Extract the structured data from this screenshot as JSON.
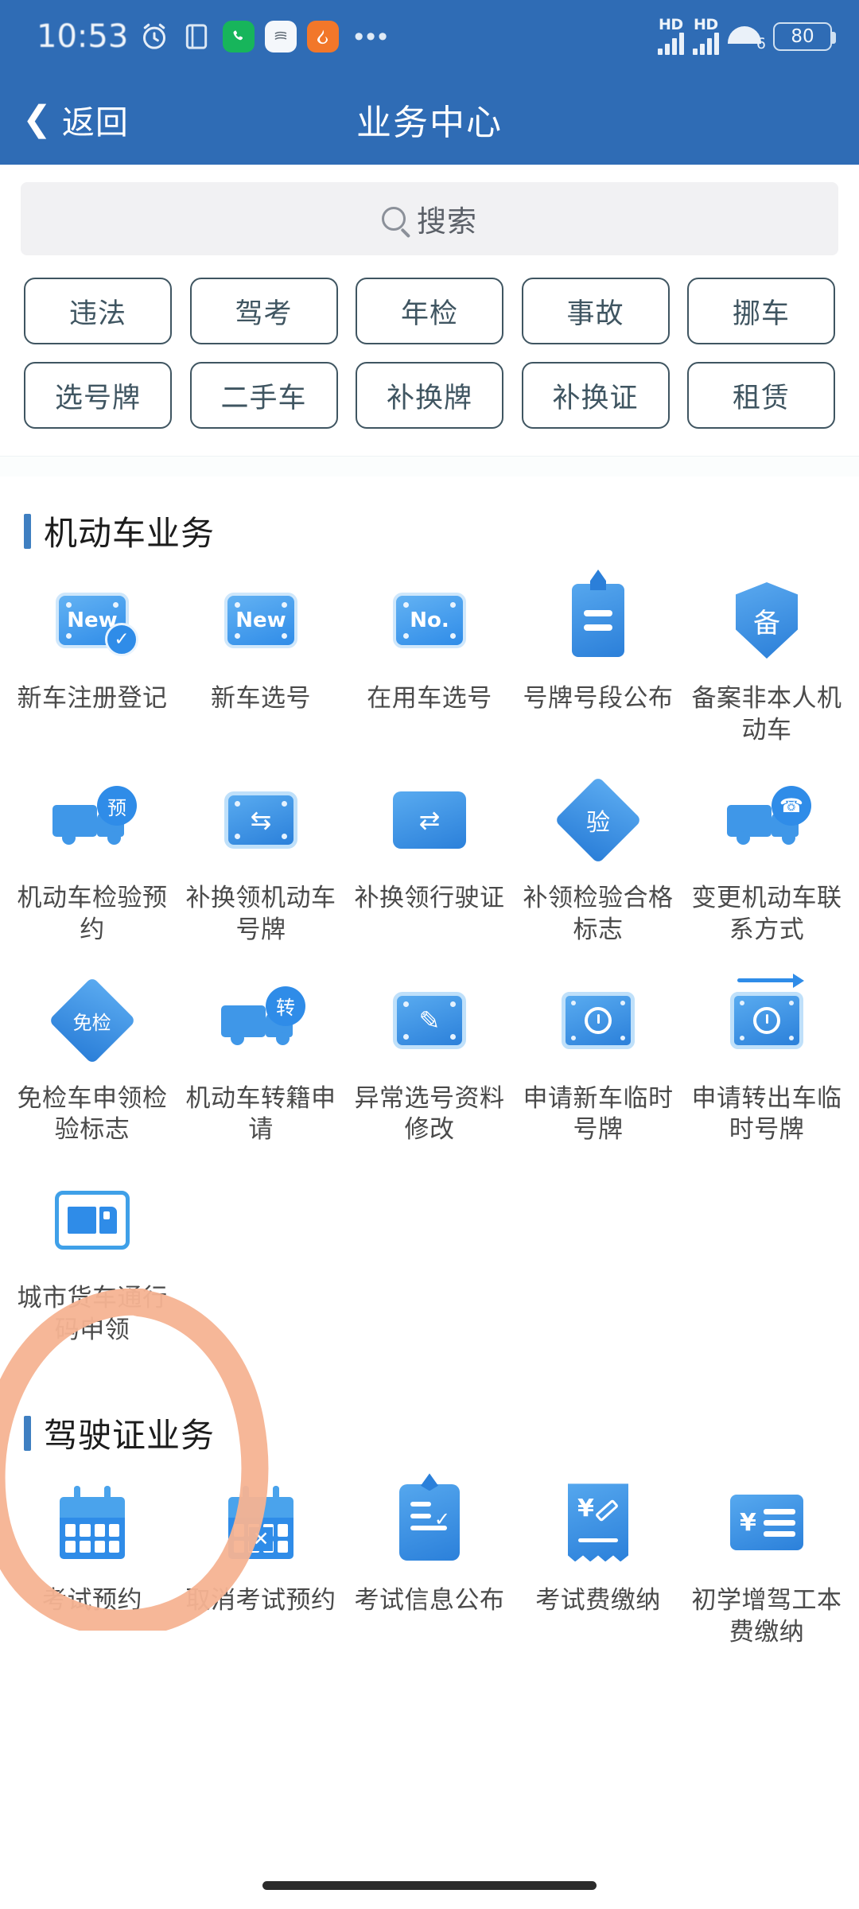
{
  "status_bar": {
    "time": "10:53",
    "left_icons": [
      "alarm-clock-icon",
      "document-icon",
      "phone-app-icon",
      "china-mobile-app-icon",
      "browser-app-icon",
      "more-dots-icon"
    ],
    "signal_1_label": "HD",
    "signal_2_label": "HD",
    "wifi_generation": "6",
    "battery_percent": "80"
  },
  "nav": {
    "back_label": "返回",
    "title": "业务中心"
  },
  "search": {
    "placeholder": "搜索",
    "icon": "search-icon"
  },
  "tags": {
    "row1": [
      "违法",
      "驾考",
      "年检",
      "事故",
      "挪车"
    ],
    "row2": [
      "选号牌",
      "二手车",
      "补换牌",
      "补换证",
      "租赁"
    ]
  },
  "sections": [
    {
      "title": "机动车业务",
      "items": [
        {
          "label": "新车注册登记",
          "icon": "plate-new-check-icon",
          "glyph": "New"
        },
        {
          "label": "新车选号",
          "icon": "plate-new-icon",
          "glyph": "New"
        },
        {
          "label": "在用车选号",
          "icon": "plate-number-icon",
          "glyph": "No."
        },
        {
          "label": "号牌号段公布",
          "icon": "hangtag-icon",
          "glyph": ""
        },
        {
          "label": "备案非本人机动车",
          "icon": "shield-record-icon",
          "glyph": "备"
        },
        {
          "label": "机动车检验预约",
          "icon": "truck-appointment-icon",
          "glyph": "预"
        },
        {
          "label": "补换领机动车号牌",
          "icon": "plate-exchange-icon",
          "glyph": "⇄"
        },
        {
          "label": "补换领行驶证",
          "icon": "vehicle-license-exchange-icon",
          "glyph": "⇄"
        },
        {
          "label": "补领检验合格标志",
          "icon": "diamond-inspect-icon",
          "glyph": "验"
        },
        {
          "label": "变更机动车联系方式",
          "icon": "truck-phone-icon",
          "glyph": "☏"
        },
        {
          "label": "免检车申领检验标志",
          "icon": "diamond-exempt-icon",
          "glyph": "免检"
        },
        {
          "label": "机动车转籍申请",
          "icon": "truck-transfer-icon",
          "glyph": "转"
        },
        {
          "label": "异常选号资料修改",
          "icon": "plate-edit-icon",
          "glyph": "✎"
        },
        {
          "label": "申请新车临时号牌",
          "icon": "temp-plate-clock-icon",
          "glyph": ""
        },
        {
          "label": "申请转出车临时号牌",
          "icon": "temp-plate-transfer-out-icon",
          "glyph": ""
        },
        {
          "label": "城市货车通行码申领",
          "icon": "city-truck-pass-icon",
          "glyph": ""
        }
      ]
    },
    {
      "title": "驾驶证业务",
      "items": [
        {
          "label": "考试预约",
          "icon": "calendar-book-icon",
          "glyph": ""
        },
        {
          "label": "取消考试预约",
          "icon": "calendar-cancel-icon",
          "glyph": ""
        },
        {
          "label": "考试信息公布",
          "icon": "clipboard-check-icon",
          "glyph": ""
        },
        {
          "label": "考试费缴纳",
          "icon": "receipt-pay-icon",
          "glyph": "¥"
        },
        {
          "label": "初学增驾工本费缴纳",
          "icon": "fee-card-icon",
          "glyph": "¥"
        }
      ]
    }
  ],
  "annotation": {
    "shape": "hand-drawn-circle",
    "color": "#f5b392",
    "targets": [
      "城市货车通行码申领"
    ]
  },
  "colors": {
    "header_blue": "#2f6cb5",
    "accent_blue": "#3f7fc1",
    "icon_blue": "#2f8ce8",
    "chip_border": "#3f5561",
    "annotation_orange": "#f5b392"
  }
}
